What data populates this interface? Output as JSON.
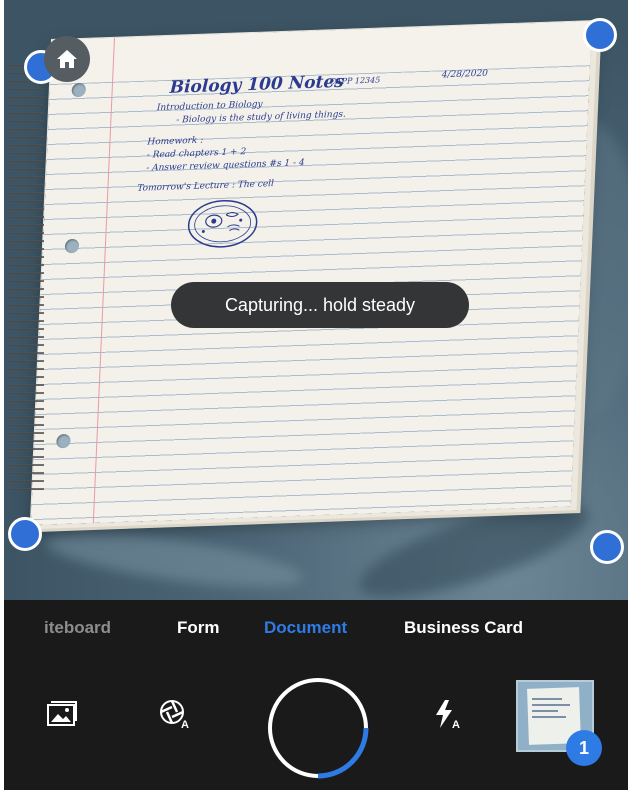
{
  "notes": {
    "title": "Biology 100 Notes",
    "course_code": "CAPP 12345",
    "date": "4/28/2020",
    "lines": [
      "Introduction to Biology",
      "- Biology is the study of living things.",
      "Homework :",
      "- Read chapters 1 + 2",
      "- Answer review questions #s 1 - 4",
      "Tomorrow's Lecture : The cell"
    ]
  },
  "toast": {
    "text": "Capturing... hold steady"
  },
  "modes": {
    "items": [
      "iteboard",
      "Form",
      "Document",
      "Business Card"
    ],
    "selected": "Document"
  },
  "toolbar": {
    "gallery_icon": "image-gallery-icon",
    "auto_capture_icon": "auto-capture-icon",
    "flash_icon": "flash-auto-icon",
    "shutter_progress": 0.25
  },
  "thumbnail": {
    "count": "1"
  },
  "colors": {
    "accent": "#2f7be6",
    "handle": "#2f6fd6",
    "ink": "#2b3c8f",
    "control_bg": "#1a1a1a"
  }
}
